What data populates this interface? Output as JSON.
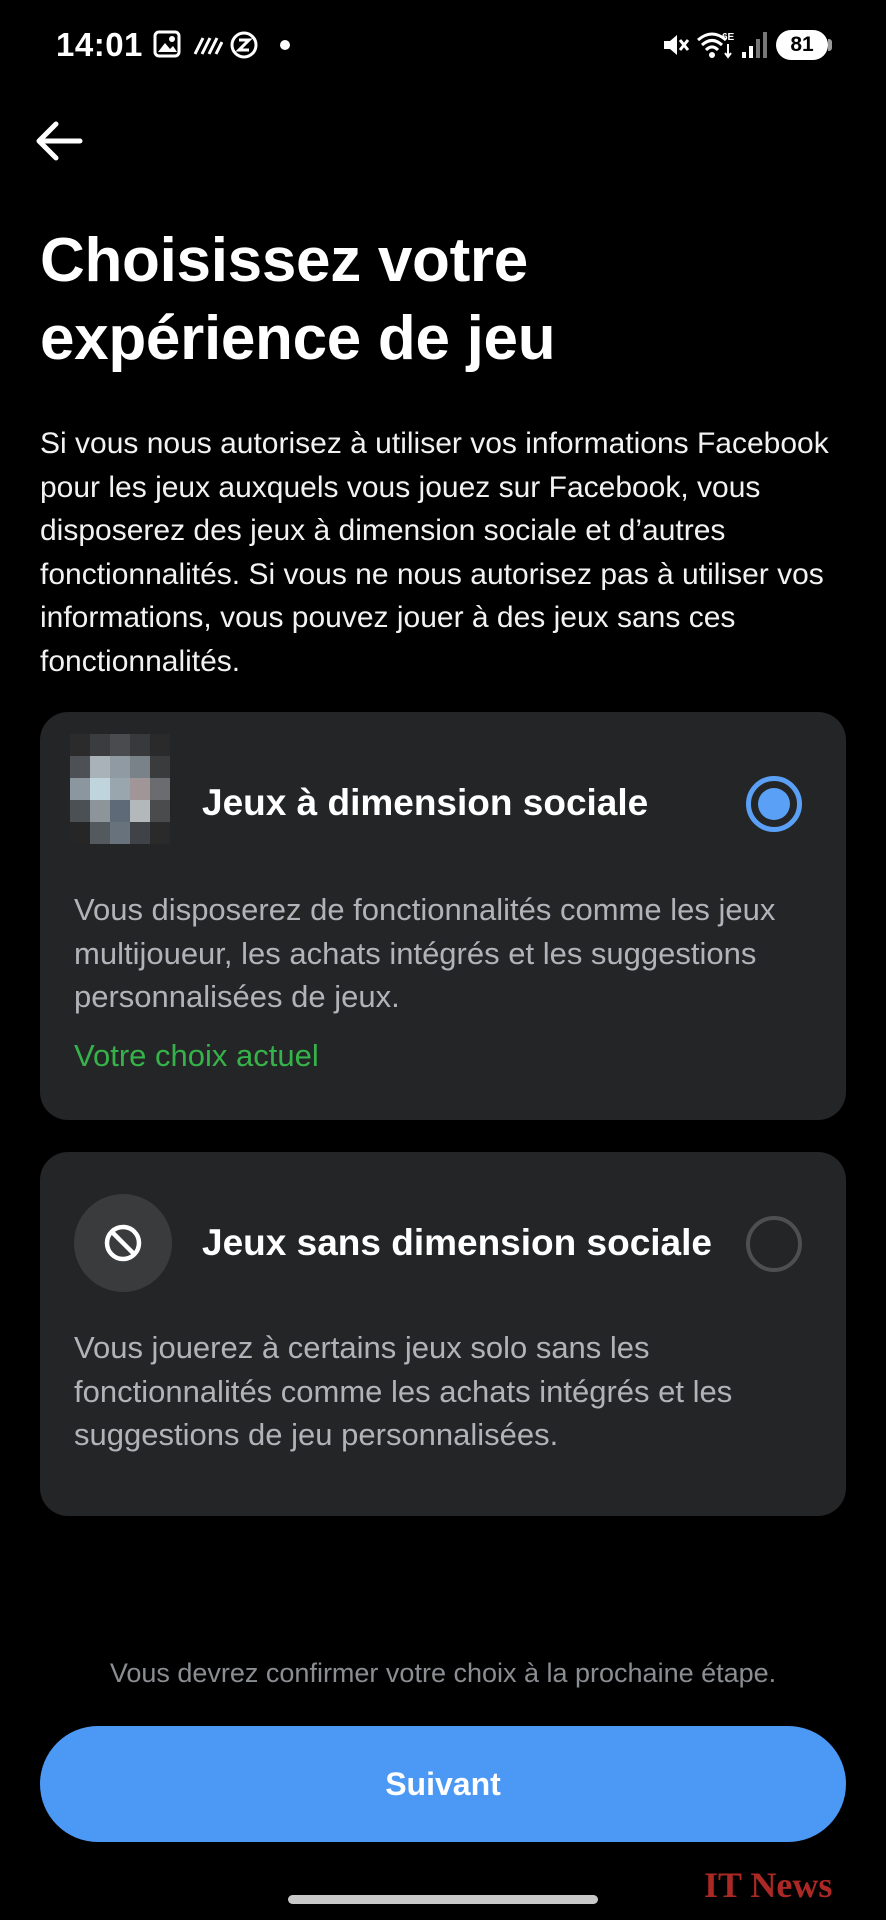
{
  "status_bar": {
    "time": "14:01",
    "battery": "81",
    "icons": [
      "image-icon",
      "ndc-icon",
      "sync-icon",
      "dot-indicator",
      "mute-icon",
      "wifi-6e-icon",
      "signal-icon",
      "battery-icon"
    ]
  },
  "header": {
    "back_icon": "arrow-left-icon",
    "title": "Choisissez votre expérience de jeu"
  },
  "intro": "Si vous nous autorisez à utiliser vos informations Facebook pour les jeux auxquels vous jouez sur Facebook, vous disposerez des jeux à dimension sociale et d’autres fonctionnalités. Si vous ne nous autorisez pas à utiliser vos informations, vous pouvez jouer à des jeux sans ces fonctionnalités.",
  "options": [
    {
      "title": "Jeux à dimension sociale",
      "description": "Vous disposerez de fonctionnalités comme les jeux multijoueur, les achats intégrés et les suggestions personnalisées de jeux.",
      "status": "Votre choix actuel",
      "selected": true,
      "icon": "blurred-avatar-image"
    },
    {
      "title": "Jeux sans dimension sociale",
      "description": "Vous jouerez à certains jeux solo sans les fonctionnalités comme les achats intégrés et les suggestions de jeu personnalisées.",
      "selected": false,
      "icon": "prohibited-icon"
    }
  ],
  "footnote": "Vous devrez confirmer votre choix à la prochaine étape.",
  "next_button": "Suivant",
  "watermark": "IT News",
  "colors": {
    "accent": "#4c99f5",
    "radio_selected": "#5aa0f7",
    "current_choice": "#36b24a",
    "card_bg": "#242526"
  }
}
